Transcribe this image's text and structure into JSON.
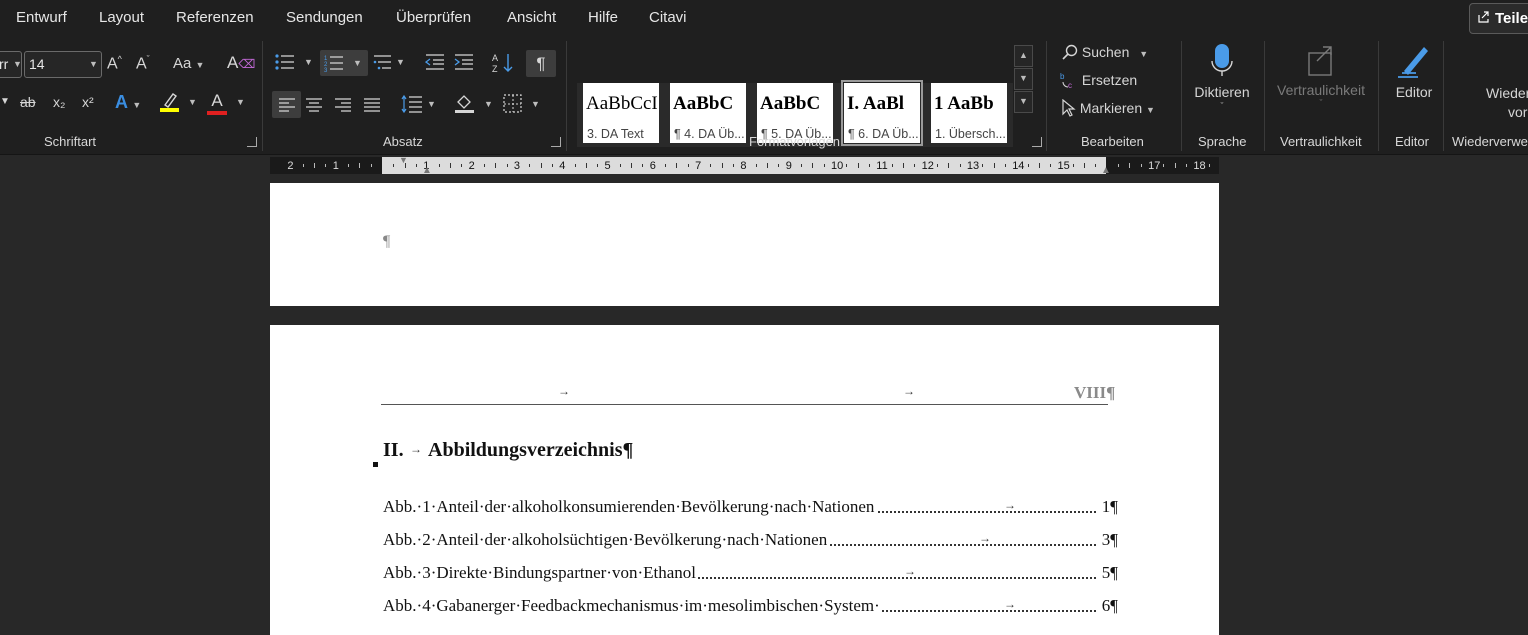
{
  "menu": {
    "items": [
      "Entwurf",
      "Layout",
      "Referenzen",
      "Sendungen",
      "Überprüfen",
      "Ansicht",
      "Hilfe",
      "Citavi"
    ],
    "share_label": "Teile"
  },
  "ribbon": {
    "font": {
      "name_partial": "rr",
      "size": "14",
      "group_label": "Schriftart",
      "grow": "A^",
      "shrink": "Aˇ",
      "case": "Aa",
      "strike": "ab",
      "subscript": "x₂",
      "superscript": "x²",
      "font_color_letter": "A",
      "highlight_color": "#ffff00",
      "font_color": "#e02020"
    },
    "paragraph": {
      "group_label": "Absatz",
      "pilcrow": "¶"
    },
    "styles": {
      "group_label": "Formatvorlagen",
      "cards": [
        {
          "sample": "AaBbCcI",
          "name": "3. DA Text"
        },
        {
          "sample": "AaBbC",
          "name": "¶ 4. DA Üb..."
        },
        {
          "sample": "AaBbC",
          "name": "¶ 5. DA Üb..."
        },
        {
          "sample": "I.   AaBl",
          "name": "¶ 6. DA Üb..."
        },
        {
          "sample": "1   AaBb",
          "name": "1. Übersch..."
        }
      ]
    },
    "editing": {
      "group_label": "Bearbeiten",
      "find": "Suchen",
      "replace": "Ersetzen",
      "select": "Markieren"
    },
    "voice": {
      "group_label": "Sprache",
      "dictate": "Diktieren",
      "mic_color": "#4a9be8"
    },
    "sensitivity": {
      "group_label": "Vertraulichkeit",
      "label": "Vertraulichkeit"
    },
    "editor": {
      "group_label": "Editor",
      "label": "Editor",
      "pen_color": "#4a9be8"
    },
    "reuse": {
      "group_label": "Wiederverwe",
      "label_line1": "Wieder",
      "label_line2": "vor"
    }
  },
  "ruler": {
    "left_numbers": [
      "2",
      "1"
    ],
    "numbers": [
      "1",
      "2",
      "3",
      "4",
      "5",
      "6",
      "7",
      "8",
      "9",
      "10",
      "11",
      "12",
      "13",
      "14",
      "15"
    ],
    "right_numbers": [
      "17",
      "18"
    ]
  },
  "document": {
    "page1": {
      "pilcrow": "¶"
    },
    "page2": {
      "header_tab_arrow": "→",
      "header_page": "VIII¶",
      "heading_number": "II.",
      "heading_arrow": "→",
      "heading_text": "Abbildungsverzeichnis¶",
      "toc": [
        {
          "text": "Abb.·1·Anteil·der·alkoholkonsumierenden·Bevölkerung·nach·Nationen",
          "page": "1¶"
        },
        {
          "text": "Abb.·2·Anteil·der·alkoholsüchtigen·Bevölkerung·nach·Nationen",
          "page": "3¶"
        },
        {
          "text": "Abb.·3·Direkte·Bindungspartner·von·Ethanol",
          "page": "5¶"
        },
        {
          "text": "Abb.·4·Gabanerger·Feedbackmechanismus·im·mesolimbischen·System·",
          "page": "6¶"
        }
      ]
    }
  }
}
